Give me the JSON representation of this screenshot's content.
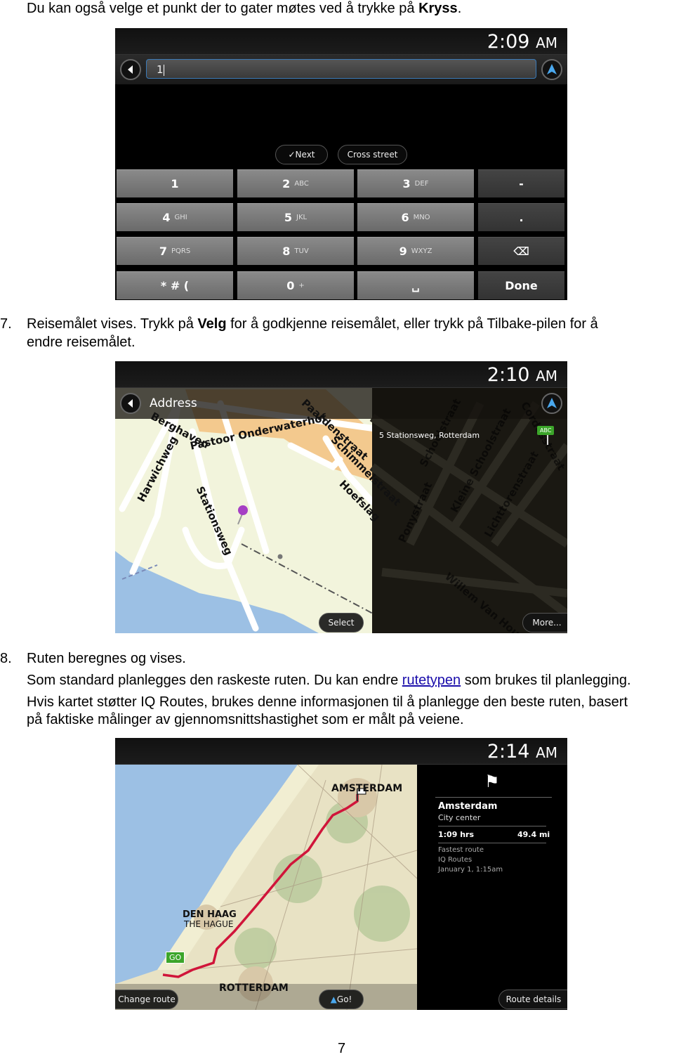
{
  "intro": {
    "pre": "Du kan også velge et punkt der to gater møtes ved å trykke på ",
    "bold": "Kryss",
    "post": "."
  },
  "step7": {
    "number": "7.",
    "line1_pre": "Reisemålet vises. Trykk på ",
    "line1_bold": "Velg",
    "line1_post": " for å godkjenne reisemålet, eller trykk på Tilbake-pilen for å",
    "line2": "endre reisemålet."
  },
  "step8": {
    "number": "8.",
    "line1": "Ruten beregnes og vises.",
    "para1_pre": "Som standard planlegges den raskeste ruten. Du kan endre ",
    "para1_link": "rutetypen",
    "para1_post": " som brukes til planlegging.",
    "para2_line1": "Hvis kartet støtter IQ Routes, brukes denne informasjonen til å planlegge den beste ruten, basert",
    "para2_line2": "på faktiske målinger av gjennomsnittshastighet som er målt på veiene."
  },
  "page_number": "7",
  "screen1": {
    "time": "2:09",
    "ampm": "AM",
    "input_value": "1",
    "next_label": "Next",
    "cross_street_label": "Cross street",
    "keys": [
      {
        "main": "1",
        "sub": ""
      },
      {
        "main": "2",
        "sub": "ABC"
      },
      {
        "main": "3",
        "sub": "DEF"
      },
      {
        "main": "-",
        "sub": ""
      },
      {
        "main": "4",
        "sub": "GHI"
      },
      {
        "main": "5",
        "sub": "JKL"
      },
      {
        "main": "6",
        "sub": "MNO"
      },
      {
        "main": ".",
        "sub": ""
      },
      {
        "main": "7",
        "sub": "PQRS"
      },
      {
        "main": "8",
        "sub": "TUV"
      },
      {
        "main": "9",
        "sub": "WXYZ"
      },
      {
        "main": "⌫",
        "sub": ""
      },
      {
        "main": "* # (",
        "sub": ""
      },
      {
        "main": "0",
        "sub": "+"
      },
      {
        "main": "␣",
        "sub": ""
      },
      {
        "main": "Done",
        "sub": ""
      }
    ]
  },
  "screen2": {
    "time": "2:10",
    "ampm": "AM",
    "header_title": "Address",
    "address": "5 Stationsweg, Rotterdam",
    "sign_label": "ABC",
    "select_label": "Select",
    "more_label": "More...",
    "map_labels": [
      "Berghaven",
      "Pastoor Onderwaterhof",
      "Paardenstraat",
      "Schimmelstraat",
      "Hoefslag",
      "Harwichweg",
      "Stationsweg",
      "Schoolstraat",
      "Kleine Schoolstraat",
      "Lichttorenstraat",
      "Ponystraat",
      "Willem Van Hou",
      "Cordesstraat"
    ]
  },
  "screen3": {
    "time": "2:14",
    "ampm": "AM",
    "destination": "Amsterdam",
    "destination_sub": "City center",
    "duration": "1:09 hrs",
    "distance": "49.4 mi",
    "route_type": "Fastest route",
    "routing": "IQ Routes",
    "date": "January 1,  1:15am",
    "city_labels": {
      "amsterdam": "AMSTERDAM",
      "den_haag": "DEN HAAG",
      "the_hague": "THE HAGUE",
      "rotterdam": "ROTTERDAM"
    },
    "go_marker": "GO",
    "change_route_label": "Change route",
    "go_label": "Go!",
    "route_details_label": "Route details",
    "route_color": "#d0153a"
  }
}
